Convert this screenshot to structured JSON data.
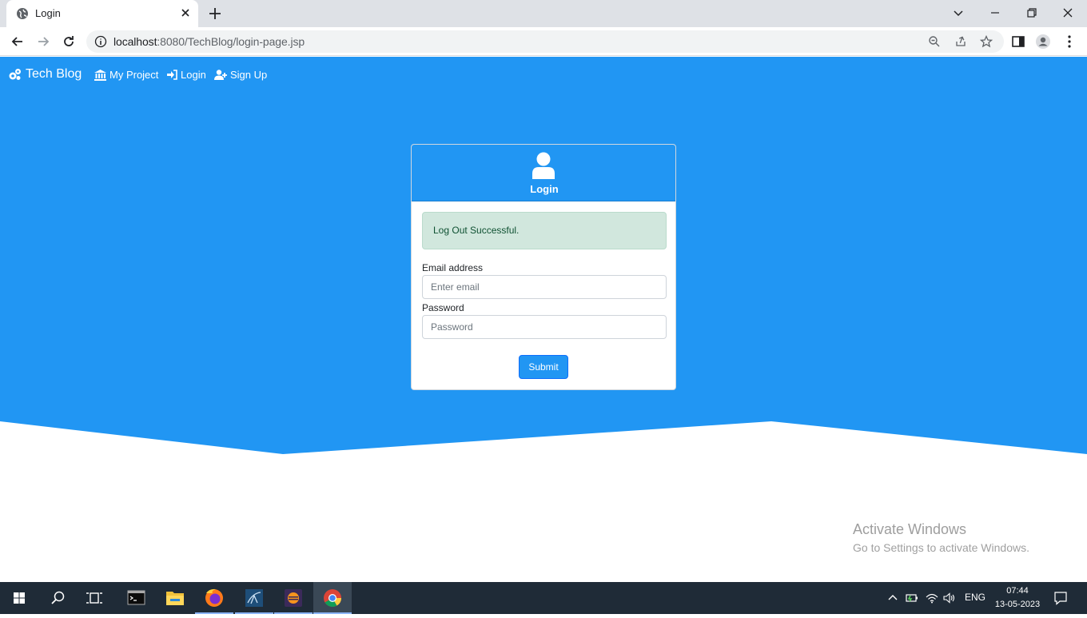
{
  "browser": {
    "tab_title": "Login",
    "url_host": "localhost",
    "url_rest": ":8080/TechBlog/login-page.jsp"
  },
  "navbar": {
    "brand": "Tech Blog",
    "links": [
      {
        "label": "My Project",
        "icon": "bank-icon"
      },
      {
        "label": "Login",
        "icon": "sign-in-icon"
      },
      {
        "label": "Sign Up",
        "icon": "user-plus-icon"
      }
    ]
  },
  "login_card": {
    "title": "Login",
    "alert": "Log Out Successful.",
    "email_label": "Email address",
    "email_placeholder": "Enter email",
    "password_label": "Password",
    "password_placeholder": "Password",
    "submit_label": "Submit"
  },
  "watermark": {
    "line1": "Activate Windows",
    "line2": "Go to Settings to activate Windows."
  },
  "taskbar": {
    "language": "ENG",
    "time": "07:44",
    "date": "13-05-2023"
  },
  "colors": {
    "primary": "#2196f3",
    "alert_bg": "#d1e7dd",
    "taskbar": "#1f2b37"
  }
}
